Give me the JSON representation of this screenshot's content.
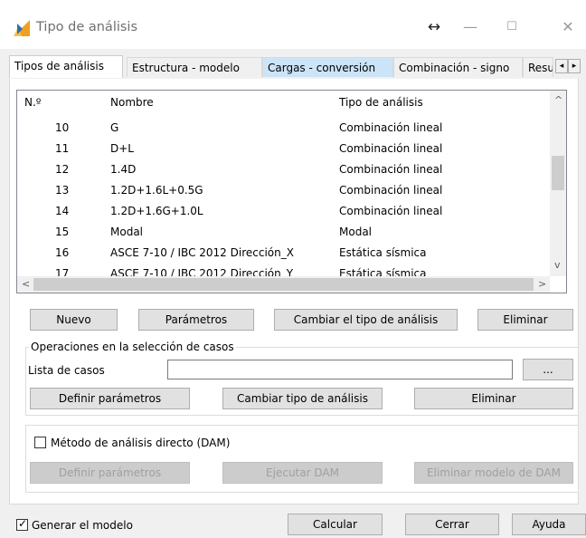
{
  "window": {
    "title": "Tipo de análisis",
    "resize_glyph": "↔",
    "minimize_glyph": "—",
    "maximize_glyph": "☐",
    "close_glyph": "✕",
    "icon": "app-icon"
  },
  "tabs": [
    {
      "label": "Tipos de análisis"
    },
    {
      "label": "Estructura - modelo"
    },
    {
      "label": "Cargas - conversión"
    },
    {
      "label": "Combinación - signo"
    },
    {
      "label": "Resu"
    }
  ],
  "tab_scroll": {
    "left": "◂",
    "right": "▸"
  },
  "list": {
    "headers": [
      "N.º",
      "Nombre",
      "Tipo de análisis"
    ],
    "rows": [
      {
        "n": "10",
        "nombre": "G",
        "tipo": "Combinación lineal"
      },
      {
        "n": "11",
        "nombre": "D+L",
        "tipo": "Combinación lineal"
      },
      {
        "n": "12",
        "nombre": "1.4D",
        "tipo": "Combinación lineal"
      },
      {
        "n": "13",
        "nombre": "1.2D+1.6L+0.5G",
        "tipo": "Combinación lineal"
      },
      {
        "n": "14",
        "nombre": "1.2D+1.6G+1.0L",
        "tipo": "Combinación lineal"
      },
      {
        "n": "15",
        "nombre": "Modal",
        "tipo": "Modal"
      },
      {
        "n": "16",
        "nombre": "ASCE 7-10 / IBC 2012 Dirección_X",
        "tipo": "Estática sísmica"
      },
      {
        "n": "17",
        "nombre": "ASCE 7-10 / IBC 2012 Dirección_Y",
        "tipo": "Estática sísmica"
      }
    ],
    "scroll_up": "^",
    "scroll_down": "v",
    "scroll_left": "<",
    "scroll_right": ">"
  },
  "buttons": {
    "nuevo": "Nuevo",
    "parametros": "Parámetros",
    "cambiar_tipo": "Cambiar el tipo de análisis",
    "eliminar": "Eliminar"
  },
  "ops": {
    "legend": "Operaciones en la selección de casos",
    "lista_label": "Lista de casos",
    "lista_value": "",
    "browse": "...",
    "definir": "Definir parámetros",
    "cambiar": "Cambiar tipo de análisis",
    "eliminar": "Eliminar"
  },
  "dam": {
    "label": "Método de análisis directo (DAM)",
    "checked": false,
    "definir": "Definir parámetros",
    "ejecutar": "Ejecutar DAM",
    "eliminar": "Eliminar modelo de DAM"
  },
  "footer": {
    "generar_label": "Generar el modelo",
    "generar_checked": true,
    "calcular": "Calcular",
    "cerrar": "Cerrar",
    "ayuda": "Ayuda"
  },
  "colors": {
    "accent_tab": "#cce4f7",
    "icon_orange": "#f0a020"
  }
}
